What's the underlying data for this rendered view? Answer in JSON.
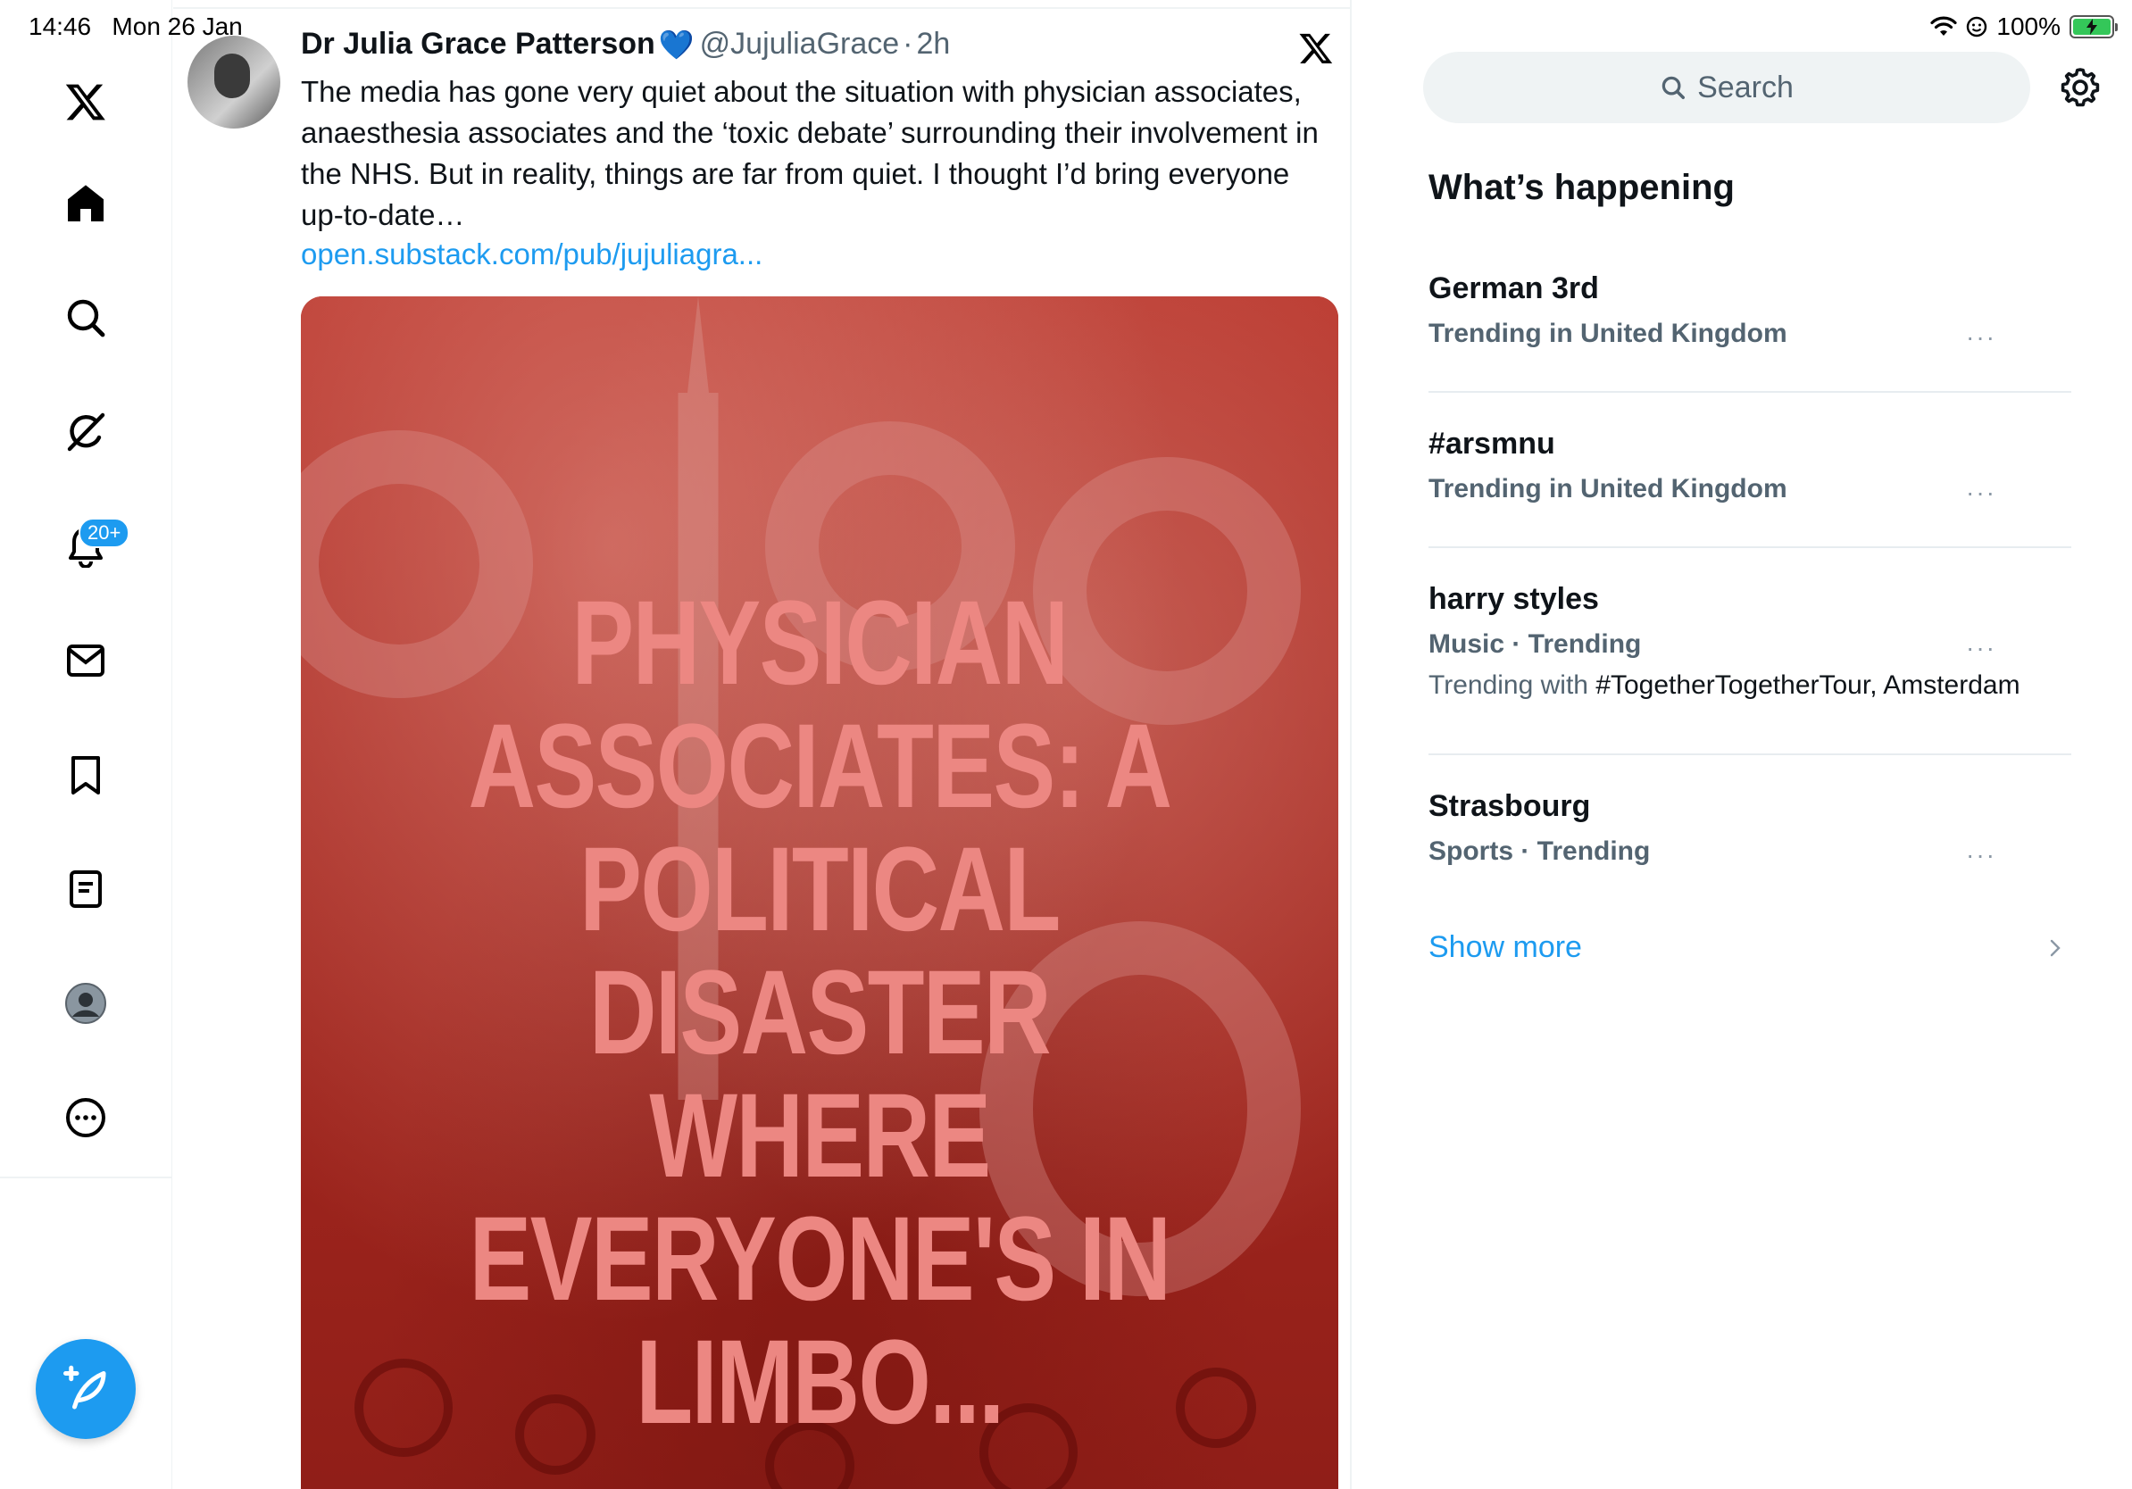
{
  "status_bar": {
    "time": "14:46",
    "date": "Mon 26 Jan",
    "battery": "100%"
  },
  "nav": {
    "items": [
      {
        "name": "home",
        "icon": "home-icon"
      },
      {
        "name": "explore",
        "icon": "search-icon"
      },
      {
        "name": "grok",
        "icon": "grok-icon"
      },
      {
        "name": "notifications",
        "icon": "bell-icon"
      },
      {
        "name": "messages",
        "icon": "mail-icon"
      },
      {
        "name": "bookmarks",
        "icon": "bookmark-icon"
      },
      {
        "name": "lists",
        "icon": "list-icon"
      },
      {
        "name": "profile",
        "icon": "avatar-icon"
      },
      {
        "name": "more",
        "icon": "more-circle-icon"
      }
    ],
    "notifications_badge": "20+"
  },
  "tweet": {
    "author_name": "Dr Julia Grace Patterson",
    "verified_emoji": "💙",
    "handle": "@JujuliaGrace",
    "separator": "·",
    "time_ago": "2h",
    "text": "The media has gone very quiet about the situation with physician associates, anaesthesia associates and the ‘toxic debate’ surrounding their involvement in the NHS. But in reality, things are far from quiet. I thought I’d bring everyone up-to-date…",
    "link": "open.substack.com/pub/jujuliagra...",
    "media_title": "PHYSICIAN\nASSOCIATES: A\nPOLITICAL\nDISASTER WHERE\nEVERYONE'S IN\nLIMBO..."
  },
  "sidebar": {
    "search_placeholder": "Search",
    "section_title": "What’s happening",
    "trends": [
      {
        "name": "German 3rd",
        "meta": "Trending in United Kingdom"
      },
      {
        "name": "#arsmnu",
        "meta": "Trending in United Kingdom"
      },
      {
        "name": "harry styles",
        "meta": "Music · Trending",
        "extra_prefix": "Trending with ",
        "extra_highlight": "#TogetherTogetherTour, Amsterdam"
      },
      {
        "name": "Strasbourg",
        "meta": "Sports · Trending"
      }
    ],
    "more_label": "···",
    "show_more": "Show more"
  },
  "colors": {
    "accent": "#1d9bf0",
    "text": "#0f1419",
    "muted": "#536471",
    "media_red": "#a82a22",
    "media_title": "#ec8782"
  }
}
